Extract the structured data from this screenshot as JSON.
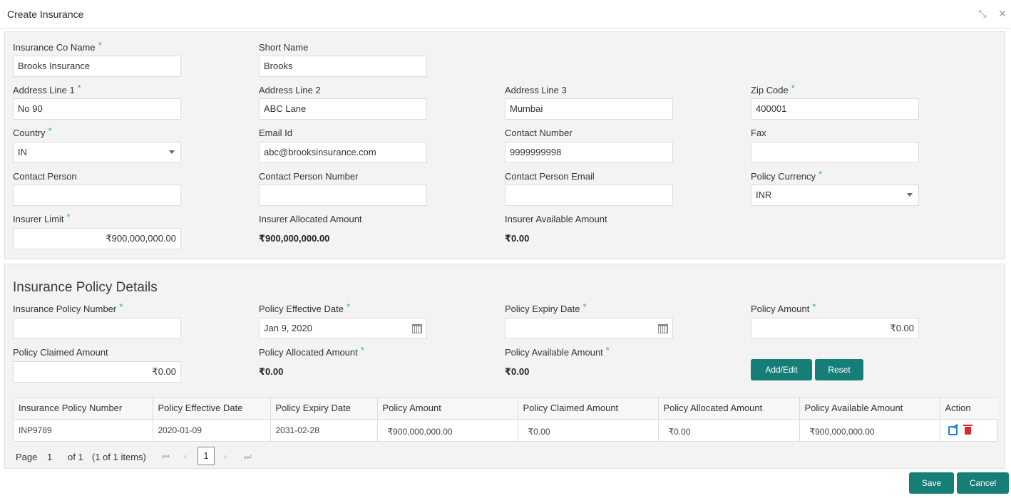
{
  "window": {
    "title": "Create Insurance"
  },
  "form": {
    "insurance_co_name": {
      "label": "Insurance Co Name",
      "value": "Brooks Insurance"
    },
    "short_name": {
      "label": "Short Name",
      "value": "Brooks"
    },
    "address_line_1": {
      "label": "Address Line 1",
      "value": "No 90"
    },
    "address_line_2": {
      "label": "Address Line 2",
      "value": "ABC Lane"
    },
    "address_line_3": {
      "label": "Address Line 3",
      "value": "Mumbai"
    },
    "zip_code": {
      "label": "Zip Code",
      "value": "400001"
    },
    "country": {
      "label": "Country",
      "value": "IN"
    },
    "email_id": {
      "label": "Email Id",
      "value": "abc@brooksinsurance.com"
    },
    "contact_number": {
      "label": "Contact Number",
      "value": "9999999998"
    },
    "fax": {
      "label": "Fax",
      "value": ""
    },
    "contact_person": {
      "label": "Contact Person",
      "value": ""
    },
    "contact_person_number": {
      "label": "Contact Person Number",
      "value": ""
    },
    "contact_person_email": {
      "label": "Contact Person Email",
      "value": ""
    },
    "policy_currency": {
      "label": "Policy Currency",
      "value": "INR"
    },
    "insurer_limit": {
      "label": "Insurer Limit",
      "value": "₹900,000,000.00"
    },
    "insurer_allocated_amount": {
      "label": "Insurer Allocated Amount",
      "value": "₹900,000,000.00"
    },
    "insurer_available_amount": {
      "label": "Insurer Available Amount",
      "value": "₹0.00"
    },
    "required_mark": "*"
  },
  "policy": {
    "section_title": "Insurance Policy Details",
    "policy_number": {
      "label": "Insurance Policy Number",
      "value": ""
    },
    "effective_date": {
      "label": "Policy Effective Date",
      "value": "Jan 9, 2020"
    },
    "expiry_date": {
      "label": "Policy Expiry Date",
      "value": ""
    },
    "policy_amount": {
      "label": "Policy Amount",
      "value": "₹0.00"
    },
    "claimed_amount": {
      "label": "Policy Claimed Amount",
      "value": "₹0.00"
    },
    "allocated_amount": {
      "label": "Policy Allocated Amount",
      "value": "₹0.00"
    },
    "available_amount": {
      "label": "Policy Available Amount",
      "value": "₹0.00"
    },
    "add_edit_label": "Add/Edit",
    "reset_label": "Reset"
  },
  "grid": {
    "columns": [
      "Insurance Policy Number",
      "Policy Effective Date",
      "Policy Expiry Date",
      "Policy Amount",
      "Policy Claimed Amount",
      "Policy Allocated Amount",
      "Policy Available Amount",
      "Action"
    ],
    "rows": [
      [
        "INP9789",
        "2020-01-09",
        "2031-02-28",
        "₹900,000,000.00",
        "₹0.00",
        "₹0.00",
        "₹900,000,000.00"
      ]
    ],
    "action_icons": [
      "edit-icon",
      "delete-icon"
    ]
  },
  "pager": {
    "page_label": "Page",
    "page_value": "1",
    "of_label": "of 1",
    "items_label": "(1 of 1 items)",
    "current": "1"
  },
  "footer": {
    "save_label": "Save",
    "cancel_label": "Cancel"
  },
  "colors": {
    "primary_button": "#157f77",
    "required": "#2aa8c6",
    "edit_icon": "#1e7fd6",
    "delete_icon": "#e3262a"
  }
}
